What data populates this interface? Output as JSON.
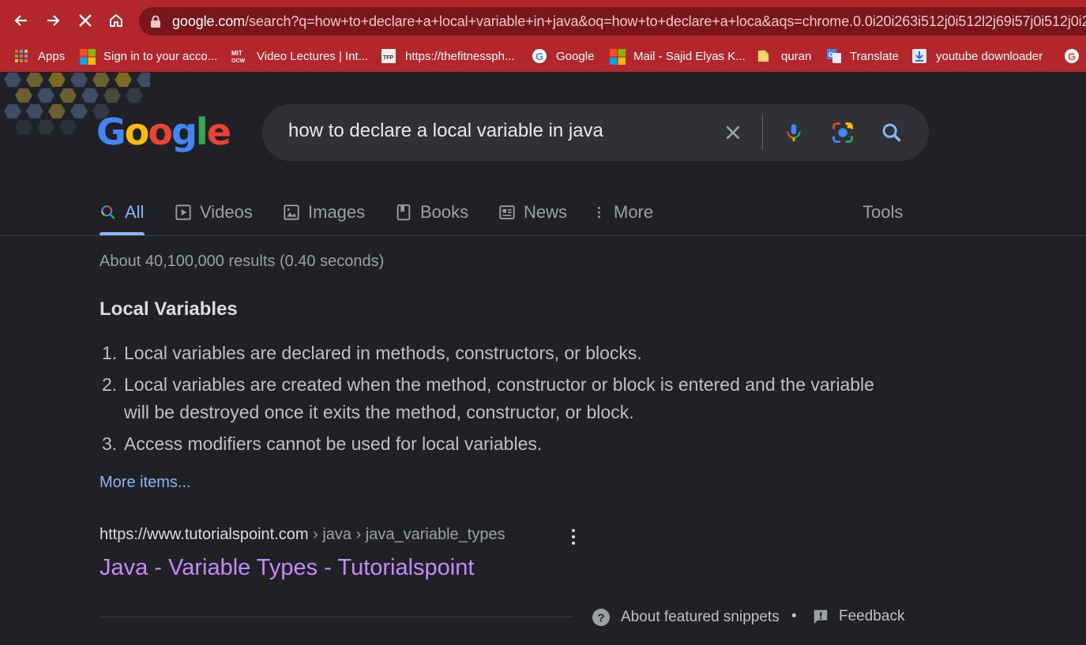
{
  "browser": {
    "url_host": "google.com",
    "url_rest": "/search?q=how+to+declare+a+local+variable+in+java&oq=how+to+declare+a+loca&aqs=chrome.0.0i20i263i512j0i512l2j69i57j0i512j0i2",
    "bookmarks": [
      {
        "label": "Apps",
        "icon": "apps-grid-icon"
      },
      {
        "label": "Sign in to your acco...",
        "icon": "microsoft-icon"
      },
      {
        "label": "Video Lectures | Int...",
        "icon": "mit-ocw-icon"
      },
      {
        "label": "https://thefitnessph...",
        "icon": "fitness-site-icon"
      },
      {
        "label": "Google",
        "icon": "google-g-icon"
      },
      {
        "label": "Mail - Sajid Elyas K...",
        "icon": "microsoft-icon"
      },
      {
        "label": "quran",
        "icon": "folder-icon"
      },
      {
        "label": "Translate",
        "icon": "google-translate-icon"
      },
      {
        "label": "youtube downloader",
        "icon": "download-icon"
      }
    ]
  },
  "google": {
    "logo_text": "Google",
    "query": "how to declare a local variable in java",
    "tabs": [
      {
        "label": "All",
        "icon": "search-icon",
        "active": true
      },
      {
        "label": "Videos",
        "icon": "video-icon"
      },
      {
        "label": "Images",
        "icon": "image-icon"
      },
      {
        "label": "Books",
        "icon": "book-icon"
      },
      {
        "label": "News",
        "icon": "news-icon"
      },
      {
        "label": "More",
        "icon": "more-vertical-icon"
      }
    ],
    "tools_label": "Tools",
    "result_stats": "About 40,100,000 results (0.40 seconds)"
  },
  "snippet": {
    "title": "Local Variables",
    "items": [
      "Local variables are declared in methods, constructors, or blocks.",
      "Local variables are created when the method, constructor or block is entered and the variable will be destroyed once it exits the method, constructor, or block.",
      "Access modifiers cannot be used for local variables."
    ],
    "numbers": [
      "1.",
      "2.",
      "3."
    ],
    "more_items_label": "More items...",
    "cite_domain": "https://www.tutorialspoint.com",
    "cite_path": " › java › java_variable_types",
    "result_title": "Java - Variable Types - Tutorialspoint",
    "about_label": "About featured snippets",
    "separator": "•",
    "feedback_label": "Feedback"
  },
  "colors": {
    "chrome_frame": "#b3262b",
    "page_bg": "#202124",
    "link_blue": "#8ab4f8",
    "visited_purple": "#c58af9"
  }
}
